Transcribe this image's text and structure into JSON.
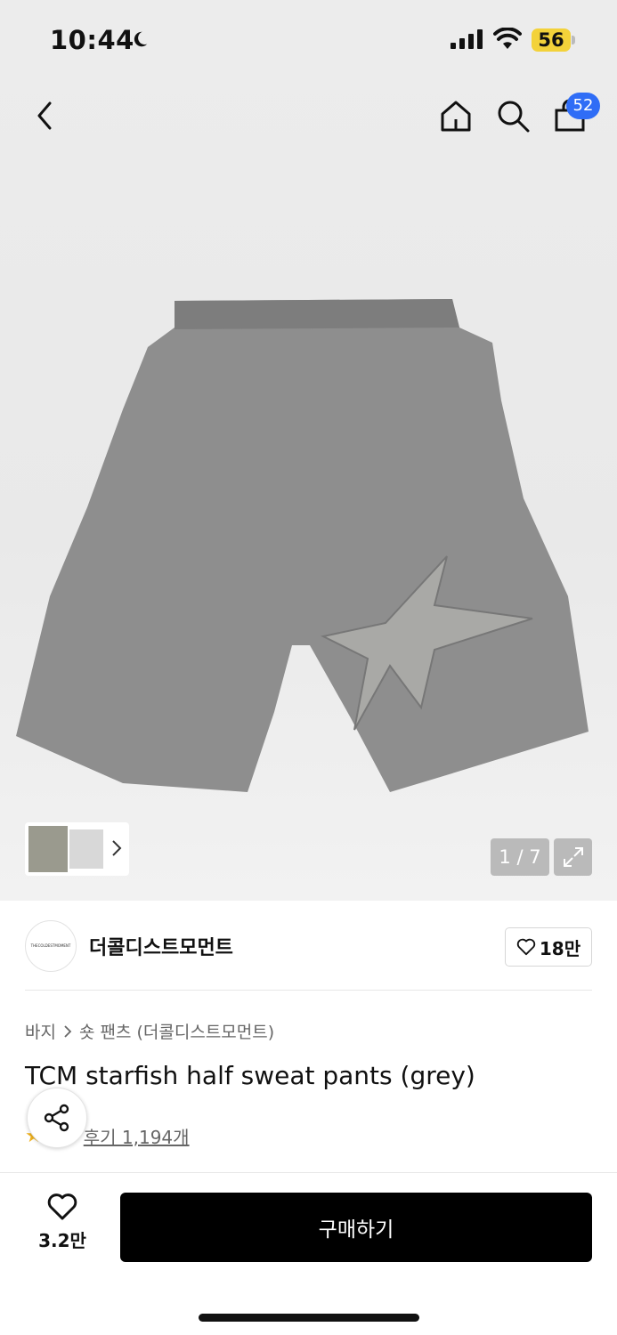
{
  "status_bar": {
    "time": "10:44",
    "battery": "56"
  },
  "header": {
    "cart_count": "52"
  },
  "gallery": {
    "counter": "1 / 7"
  },
  "brand": {
    "name": "더콜디스트모먼트",
    "logo_text": "THECOLDESTMOMENT",
    "follow_count": "18만"
  },
  "breadcrumb": {
    "category": "바지",
    "subcategory": "숏 팬츠 (더콜디스트모먼트)"
  },
  "product": {
    "title": "TCM starfish half sweat pants (grey)",
    "reviews": "후기 1,194개"
  },
  "bottom_bar": {
    "like_count": "3.2만",
    "buy_label": "구매하기"
  },
  "colors": {
    "badge": "#2f6df6",
    "battery": "#f3d23a",
    "star": "#f1b21c",
    "buy_button": "#000000"
  }
}
